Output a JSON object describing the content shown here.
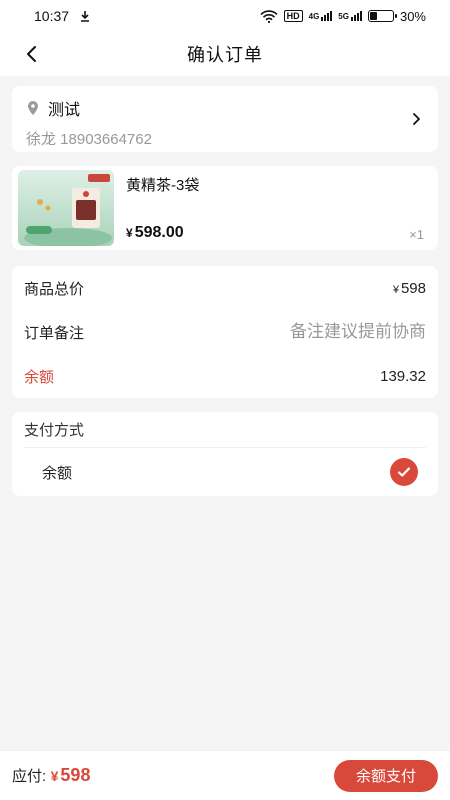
{
  "status_bar": {
    "time": "10:37",
    "download_icon": "download-icon",
    "wifi_icon": "wifi-icon",
    "hd_label": "HD",
    "signal_4g_label": "4G",
    "signal_5g_label": "5G",
    "battery_percent": "30%",
    "battery_level": 0.3
  },
  "nav": {
    "title": "确认订单",
    "back_icon": "back-arrow-icon"
  },
  "address": {
    "name": "测试",
    "contact": "徐龙 18903664762",
    "pin_icon": "location-pin-icon",
    "arrow_icon": "chevron-right-icon"
  },
  "product": {
    "title": "黄精茶-3袋",
    "currency": "¥",
    "price": "598.00",
    "quantity": "×1"
  },
  "summary": {
    "total_label": "商品总价",
    "total_currency": "¥",
    "total_value": "598",
    "remark_label": "订单备注",
    "remark_placeholder": "备注建议提前协商",
    "balance_label": "余额",
    "balance_value": "139.32"
  },
  "payment": {
    "heading": "支付方式",
    "option_label": "余额",
    "selected": true
  },
  "bottom_bar": {
    "due_label": "应付:",
    "due_currency": "¥",
    "due_value": "598",
    "pay_button": "余额支付"
  },
  "colors": {
    "accent": "#d9493b",
    "page_bg": "#f5f5f5"
  }
}
